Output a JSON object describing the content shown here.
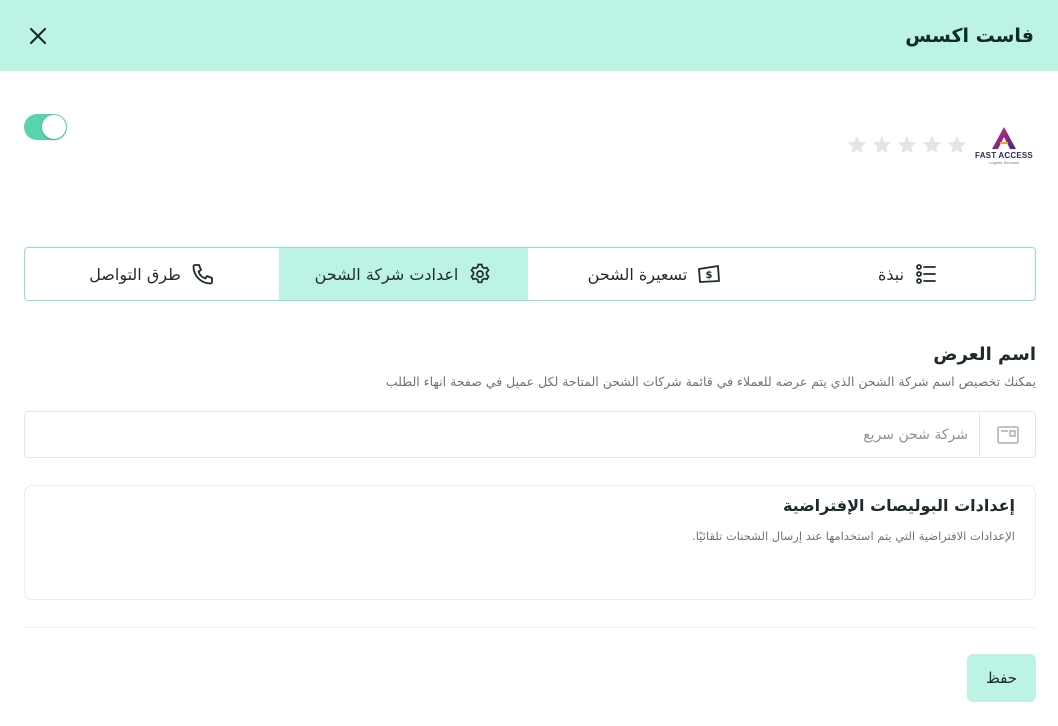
{
  "header": {
    "title": "فاست اكسس"
  },
  "brand": {
    "logo_text": "FAST ACCESS",
    "logo_sub": "Logistic Services",
    "rating": 0,
    "max_rating": 5,
    "enabled": true
  },
  "tabs": [
    {
      "label": "نبذة",
      "icon": "list-icon"
    },
    {
      "label": "تسعيرة الشحن",
      "icon": "money-icon"
    },
    {
      "label": "اعدادت شركة الشحن",
      "icon": "gear-icon"
    },
    {
      "label": "طرق التواصل",
      "icon": "phone-icon"
    }
  ],
  "active_tab": 2,
  "display_name": {
    "title": "اسم العرض",
    "description": "يمكنك تخصيص اسم شركة الشحن الذي يتم عرضه للعملاء في قائمة شركات الشحن المتاحة لكل عميل في صفحة انهاء الطلب",
    "placeholder": "شركة شحن سريع",
    "value": ""
  },
  "policies": {
    "title": "إعدادات البوليصات الإفتراضية",
    "description": "الإعدادات الافتراضية التي يتم استخدامها عند إرسال الشحنات تلقائيًا."
  },
  "footer": {
    "save_label": "حفظ"
  },
  "colors": {
    "accent_light": "#bdf3e5",
    "toggle_on": "#59d3ae",
    "tab_border": "#8fe0c8"
  }
}
